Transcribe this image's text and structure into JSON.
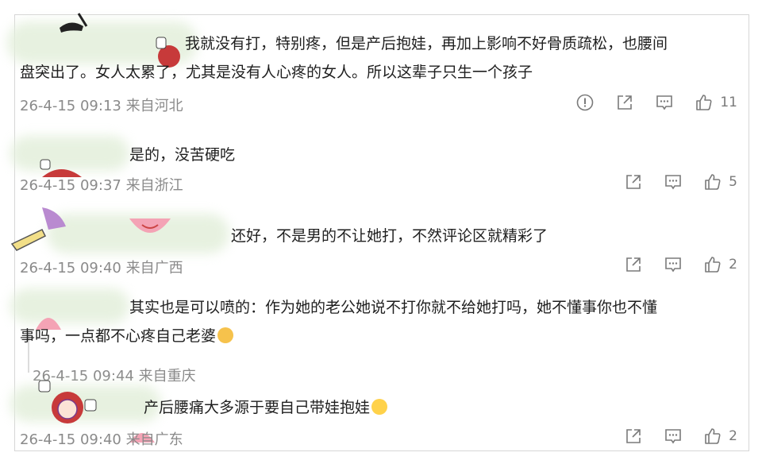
{
  "comments": [
    {
      "line1": "我就没有打，特别疼，但是产后抱娃，再加上影响不好骨质疏松，也腰间",
      "line2": "盘突出了。女人太累了，尤其是没有人心疼的女人。所以这辈子只生一个孩子",
      "meta": "26-4-15 09:13 来自河北",
      "likes": "11"
    },
    {
      "line1": "是的，没苦硬吃",
      "meta": "26-4-15 09:37 来自浙江",
      "likes": "5"
    },
    {
      "line1": "还好，不是男的不让她打，不然评论区就精彩了",
      "meta": "26-4-15 09:40 来自广西",
      "likes": "2"
    },
    {
      "line1": "其实也是可以喷的：作为她的老公她说不打你就不给她打吗，她不懂事你也不懂",
      "line2": "事吗，一点都不心疼自己老婆",
      "meta": "26-4-15 09:44 来自重庆"
    },
    {
      "line1": "产后腰痛大多源于要自己带娃抱娃",
      "meta": "26-4-15 09:40 来自广东",
      "likes": "2"
    }
  ],
  "icons": {
    "report": "report-icon",
    "share": "share-icon",
    "reply": "comment-icon",
    "like": "thumbs-up-icon",
    "emoji_cat": "cat-face-emoji",
    "emoji_grin": "grinning-face-emoji"
  },
  "colors": {
    "meta_text": "#8a8a8a",
    "icon": "#7a7a7a",
    "blur": "#e3efdb"
  }
}
